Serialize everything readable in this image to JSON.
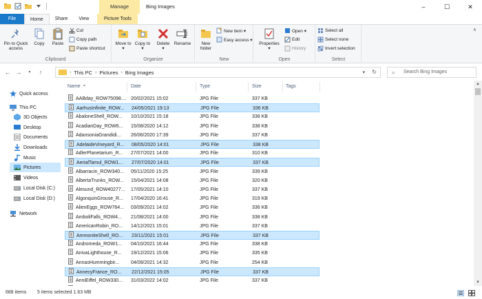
{
  "window": {
    "contextual_tab": "Manage",
    "title": "Bing Images",
    "min": "–",
    "max": "☐",
    "close": "✕"
  },
  "tabs": {
    "file": "File",
    "home": "Home",
    "share": "Share",
    "view": "View",
    "picture_tools": "Picture Tools"
  },
  "ribbon": {
    "clipboard": {
      "label": "Clipboard",
      "pin": "Pin to Quick access",
      "copy": "Copy",
      "paste": "Paste",
      "cut": "Cut",
      "copy_path": "Copy path",
      "paste_shortcut": "Paste shortcut"
    },
    "organize": {
      "label": "Organize",
      "move_to": "Move to",
      "copy_to": "Copy to",
      "delete": "Delete",
      "rename": "Rename"
    },
    "new": {
      "label": "New",
      "new_folder": "New folder",
      "new_item": "New item ▾",
      "easy_access": "Easy access ▾"
    },
    "open": {
      "label": "Open",
      "properties": "Properties",
      "open": "Open ▾",
      "edit": "Edit",
      "history": "History"
    },
    "select": {
      "label": "Select",
      "select_all": "Select all",
      "select_none": "Select none",
      "invert_selection": "Invert selection"
    }
  },
  "address": {
    "segments": [
      "This PC",
      "Pictures",
      "Bing Images"
    ],
    "search_placeholder": "Search Bing Images"
  },
  "nav": [
    {
      "label": "Quick access",
      "icon": "star-icon"
    },
    {
      "label": "This PC",
      "icon": "computer-icon"
    },
    {
      "label": "3D Objects",
      "icon": "cube-icon"
    },
    {
      "label": "Desktop",
      "icon": "desktop-folder-icon"
    },
    {
      "label": "Documents",
      "icon": "documents-icon"
    },
    {
      "label": "Downloads",
      "icon": "download-icon"
    },
    {
      "label": "Music",
      "icon": "music-icon"
    },
    {
      "label": "Pictures",
      "icon": "pictures-icon",
      "selected": true
    },
    {
      "label": "Videos",
      "icon": "videos-icon"
    },
    {
      "label": "Local Disk (C:)",
      "icon": "drive-icon"
    },
    {
      "label": "Local Disk (D:)",
      "icon": "drive-icon"
    },
    {
      "label": "Network",
      "icon": "network-icon"
    }
  ],
  "columns": {
    "name": "Name",
    "date": "Date",
    "type": "Type",
    "size": "Size",
    "tags": "Tags"
  },
  "files": [
    {
      "name": "AABday_ROW75098....",
      "date": "20/02/2021 15:02",
      "type": "JPG File",
      "size": "337 KB",
      "selected": false
    },
    {
      "name": "AarhusInfinite_ROW...",
      "date": "24/05/2021 19:13",
      "type": "JPG File",
      "size": "336 KB",
      "selected": true
    },
    {
      "name": "AbaloneShell_ROW...",
      "date": "10/10/2021 15:18",
      "type": "JPG File",
      "size": "338 KB",
      "selected": false
    },
    {
      "name": "AcadianDay_ROW6...",
      "date": "15/08/2020 14:12",
      "type": "JPG File",
      "size": "338 KB",
      "selected": false
    },
    {
      "name": "AdansoniaGrandidi...",
      "date": "26/06/2020 17:39",
      "type": "JPG File",
      "size": "337 KB",
      "selected": false
    },
    {
      "name": "AdelaideVineyard_R...",
      "date": "08/05/2020 14:01",
      "type": "JPG File",
      "size": "338 KB",
      "selected": true
    },
    {
      "name": "AdlerPlanetarium_R...",
      "date": "27/07/2021 14:00",
      "type": "JPG File",
      "size": "310 KB",
      "selected": false
    },
    {
      "name": "AerialTamul_ROW1...",
      "date": "27/07/2020 14:01",
      "type": "JPG File",
      "size": "337 KB",
      "selected": true
    },
    {
      "name": "Albarracin_ROW340...",
      "date": "05/11/2020 15:25",
      "type": "JPG File",
      "size": "339 KB",
      "selected": false
    },
    {
      "name": "AlbertaTrunks_ROW...",
      "date": "15/04/2021 14:08",
      "type": "JPG File",
      "size": "320 KB",
      "selected": false
    },
    {
      "name": "Alesund_ROW40277...",
      "date": "17/05/2021 14:10",
      "type": "JPG File",
      "size": "337 KB",
      "selected": false
    },
    {
      "name": "AlgonquinGrouse_R...",
      "date": "17/04/2020 16:41",
      "type": "JPG File",
      "size": "319 KB",
      "selected": false
    },
    {
      "name": "AlienEggs_ROW764...",
      "date": "03/09/2021 14:02",
      "type": "JPG File",
      "size": "336 KB",
      "selected": false
    },
    {
      "name": "AmboliFalls_ROW4...",
      "date": "21/08/2021 14:00",
      "type": "JPG File",
      "size": "338 KB",
      "selected": false
    },
    {
      "name": "AmericanRobin_RO...",
      "date": "14/12/2021 15:01",
      "type": "JPG File",
      "size": "337 KB",
      "selected": false
    },
    {
      "name": "AmmoniteShell_RO...",
      "date": "23/11/2021 15:01",
      "type": "JPG File",
      "size": "337 KB",
      "selected": true
    },
    {
      "name": "Andromeda_ROW1...",
      "date": "04/10/2021 16:44",
      "type": "JPG File",
      "size": "338 KB",
      "selected": false
    },
    {
      "name": "AnivaLighthouse_R...",
      "date": "19/12/2021 15:06",
      "type": "JPG File",
      "size": "335 KB",
      "selected": false
    },
    {
      "name": "AnnasHummingbir...",
      "date": "04/09/2021 14:32",
      "type": "JPG File",
      "size": "254 KB",
      "selected": false
    },
    {
      "name": "AnnecyFrance_RO...",
      "date": "22/12/2021 15:05",
      "type": "JPG File",
      "size": "337 KB",
      "selected": true
    },
    {
      "name": "AnniEiffel_ROW330...",
      "date": "31/03/2022 14:02",
      "type": "JPG File",
      "size": "337 KB",
      "selected": false
    },
    {
      "name": "AnnularEclipse_RO...",
      "date": "",
      "type": "",
      "size": "",
      "selected": false
    }
  ],
  "status": {
    "count": "688 items",
    "selected": "5 items selected  1.63 MB"
  },
  "colors": {
    "accent": "#1979ca",
    "selection": "#cce8ff",
    "contextual": "#fbe9a4"
  }
}
